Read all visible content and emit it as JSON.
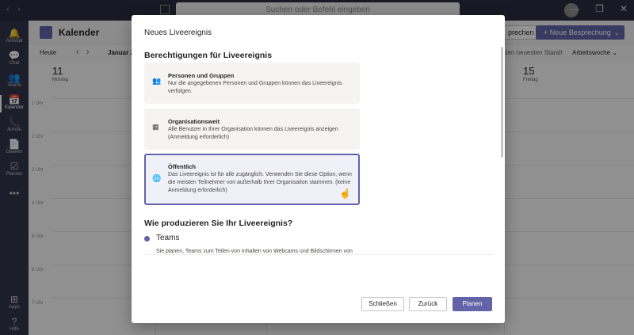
{
  "titlebar": {
    "search_placeholder": "Suchen oder Befehl eingeben",
    "nav_back": "‹",
    "nav_forward": "›",
    "window_controls": [
      "—",
      "❐",
      "✕"
    ]
  },
  "rail": [
    {
      "label": "Aktivität",
      "icon": "bell-icon",
      "glyph": "🔔"
    },
    {
      "label": "Chat",
      "icon": "chat-icon",
      "glyph": "💬"
    },
    {
      "label": "Teams",
      "icon": "teams-icon",
      "glyph": "👥"
    },
    {
      "label": "Kalender",
      "icon": "calendar-icon",
      "glyph": "📅"
    },
    {
      "label": "Anrufe",
      "icon": "phone-icon",
      "glyph": "📞"
    },
    {
      "label": "Dateien",
      "icon": "files-icon",
      "glyph": "📄"
    },
    {
      "label": "Planner",
      "icon": "planner-icon",
      "glyph": "☑"
    },
    {
      "label": "",
      "icon": "more-icon",
      "glyph": "•••"
    },
    {
      "label": "Apps",
      "icon": "apps-icon",
      "glyph": "⊞"
    },
    {
      "label": "Hilfe",
      "icon": "help-icon",
      "glyph": "?"
    }
  ],
  "header": {
    "title": "Kalender",
    "meet_button": "prechen",
    "new_meeting_button": "+ Neue Besprechung",
    "new_meeting_chevron": "⌄"
  },
  "toolbar": {
    "today": "Heute",
    "month": "Januar 2",
    "right_text": "den neuesten Stand!",
    "view": "Arbeitswoche ⌄"
  },
  "calendar": {
    "left_day_num": "11",
    "left_day_name": "Montag",
    "right_day_num": "15",
    "right_day_name": "Freitag",
    "times": [
      "1 Uhr",
      "2 Uhr",
      "3 Uhr",
      "4 Uhr",
      "5 Uhr",
      "6 Uhr",
      "7 Uhr"
    ]
  },
  "dialog": {
    "title": "Neues Liveereignis",
    "permissions_heading": "Berechtigungen für Liveereignis",
    "options": [
      {
        "title": "Personen und Gruppen",
        "description": "Nur die angegebenen Personen und Gruppen können das Liveereignis verfolgen.",
        "icon": "people-icon",
        "glyph": "👥",
        "selected": false
      },
      {
        "title": "Organisationsweit",
        "description": "Alle Benutzer in Ihrer Organisation können das Liveereignis anzeigen (Anmeldung erforderlich)",
        "icon": "building-icon",
        "glyph": "▦",
        "selected": false
      },
      {
        "title": "Öffentlich",
        "description": "Das Liveereignis ist für alle zugänglich. Verwenden Sie diese Option, wenn die meisten Teilnehmer von außerhalb Ihrer Organisation stammen. (keine Anmeldung erforderlich)",
        "icon": "globe-icon",
        "glyph": "🌐",
        "selected": true
      }
    ],
    "production_heading": "Wie produzieren Sie Ihr Liveereignis?",
    "production_option": "Teams",
    "production_desc": "Sie planen, Teams zum Teilen von Inhalten von Webcams und Bildschirmen von",
    "buttons": {
      "close": "Schließen",
      "back": "Zurück",
      "plan": "Planen"
    }
  },
  "colors": {
    "accent": "#6264a7",
    "rail": "#33344a",
    "titlebar": "#2b2b40"
  }
}
